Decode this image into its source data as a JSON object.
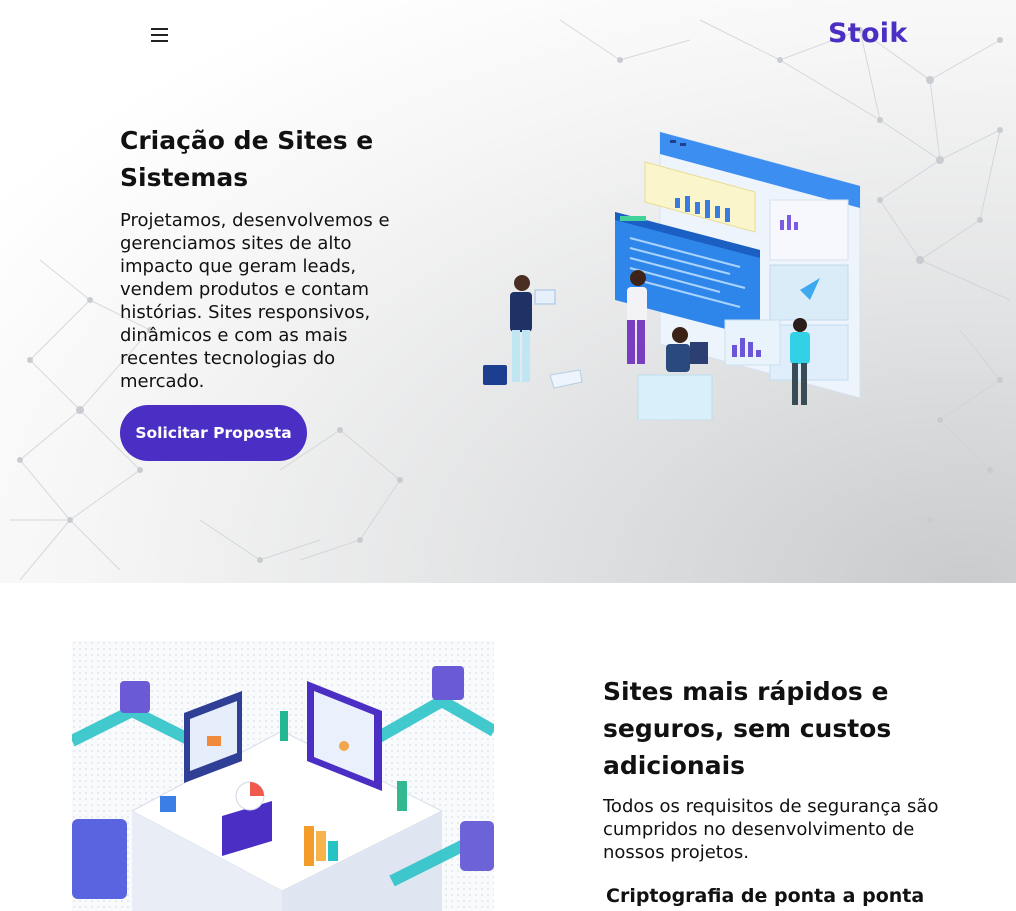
{
  "brand": {
    "logo": "Stoik",
    "color": "#4a2fc2"
  },
  "header": {
    "menu_icon": "hamburger-icon"
  },
  "hero": {
    "title": "Criação de Sites e Sistemas",
    "description": "Projetamos, desenvolvemos e gerenciamos sites de alto impacto que geram leads, vendem produtos e contam histórias. Sites responsivos, dinâmicos e com as mais recentes tecnologias do mercado.",
    "cta_label": "Solicitar Proposta",
    "cta_color": "#4b2fc4"
  },
  "section2": {
    "title": "Sites mais rápidos e seguros, sem custos adicionais",
    "description": "Todos os requisitos de segurança são cumpridos no desenvolvimento de nossos projetos.",
    "subheading": "Criptografia de ponta a ponta"
  }
}
